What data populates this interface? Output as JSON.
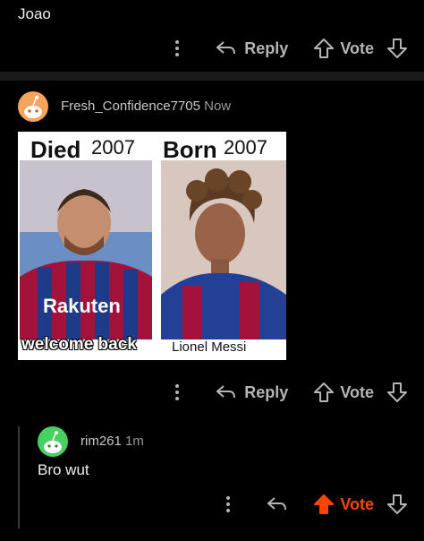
{
  "comment1": {
    "text": "Joao",
    "actions": {
      "reply": "Reply",
      "vote": "Vote"
    }
  },
  "comment2": {
    "username": "Fresh_Confidence7705",
    "time": "Now",
    "meme": {
      "left_word": "Died",
      "left_year": "2007",
      "right_word": "Born",
      "right_year": "2007",
      "left_caption": "welcome back",
      "right_caption": "Lionel Messi",
      "jersey_text": "Rakuten"
    },
    "actions": {
      "reply": "Reply",
      "vote": "Vote"
    }
  },
  "comment3": {
    "username": "rim261",
    "time": "1m",
    "text": "Bro wut",
    "actions": {
      "vote": "Vote"
    },
    "upvoted": true
  },
  "colors": {
    "background": "#000000",
    "separator": "#1a1a1b",
    "action_gray": "#b5b5b5",
    "upvote_orange": "#ff4500",
    "avatar_orange": "#f6a35c",
    "avatar_green": "#46d160"
  },
  "icons": [
    "more-vertical-icon",
    "reply-arrow-icon",
    "upvote-arrow-icon",
    "downvote-arrow-icon",
    "snoo-avatar-icon"
  ]
}
